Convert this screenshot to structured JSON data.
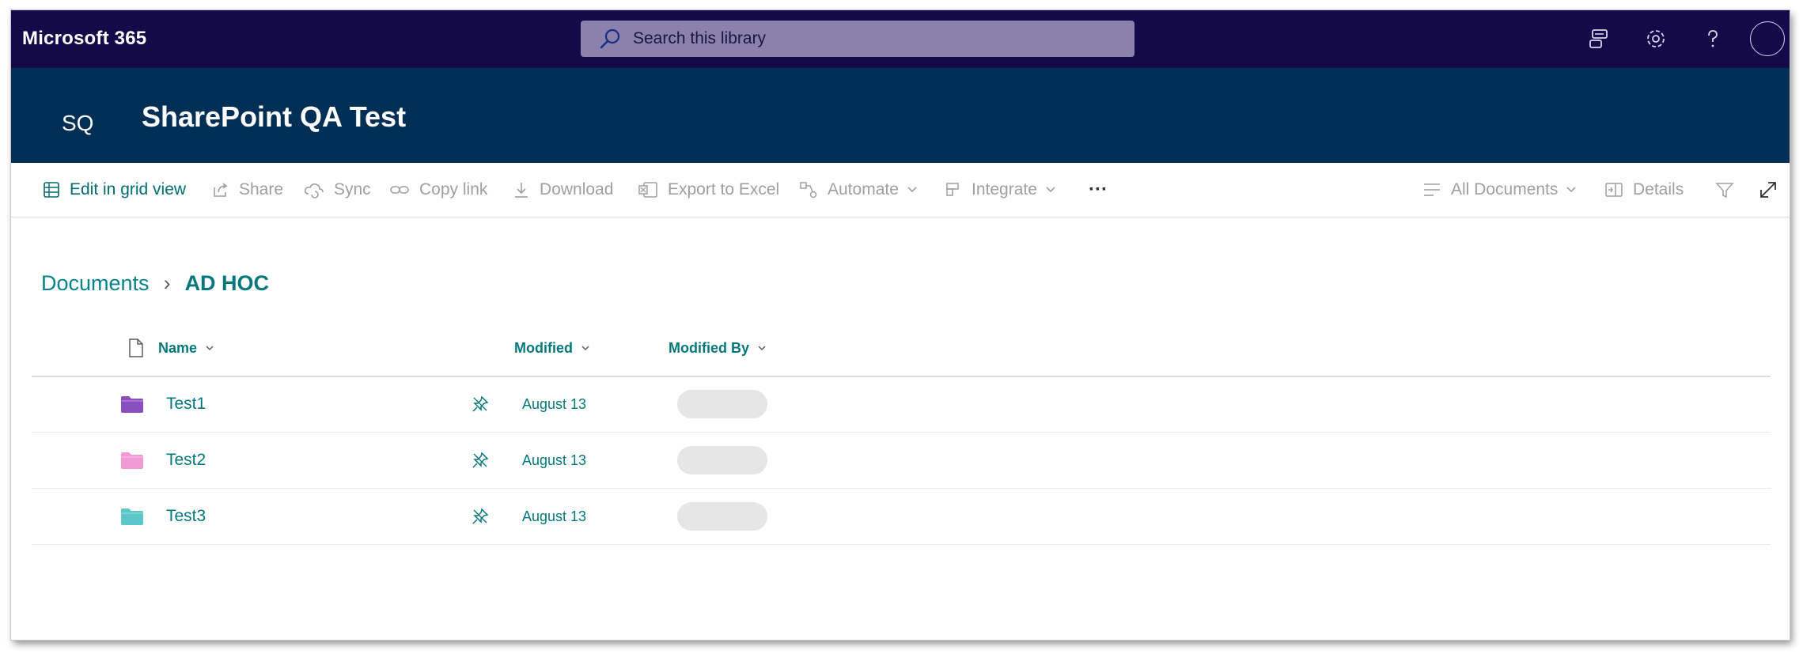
{
  "suite": {
    "brand": "Microsoft 365",
    "search_placeholder": "Search this library",
    "icons": [
      "feedback-icon",
      "gear-icon",
      "help-icon",
      "avatar"
    ]
  },
  "site": {
    "logo_text": "SQ",
    "title": "SharePoint QA Test"
  },
  "command_bar": {
    "edit_grid": "Edit in grid view",
    "share": "Share",
    "sync": "Sync",
    "copy_link": "Copy link",
    "download": "Download",
    "export_excel": "Export to Excel",
    "automate": "Automate",
    "integrate": "Integrate",
    "more": "···",
    "view_name": "All Documents",
    "details": "Details"
  },
  "breadcrumb": {
    "root": "Documents",
    "separator": "›",
    "current": "AD HOC"
  },
  "list": {
    "columns": {
      "name": "Name",
      "modified": "Modified",
      "modified_by": "Modified By"
    },
    "rows": [
      {
        "name": "Test1",
        "modified": "August 13",
        "folder_color": "#8a4fbf"
      },
      {
        "name": "Test2",
        "modified": "August 13",
        "folder_color": "#f29ad6"
      },
      {
        "name": "Test3",
        "modified": "August 13",
        "folder_color": "#5cc6c8"
      }
    ]
  },
  "colors": {
    "suite_bar": "#140a4a",
    "site_header": "#002f56",
    "accent": "#03787c"
  }
}
